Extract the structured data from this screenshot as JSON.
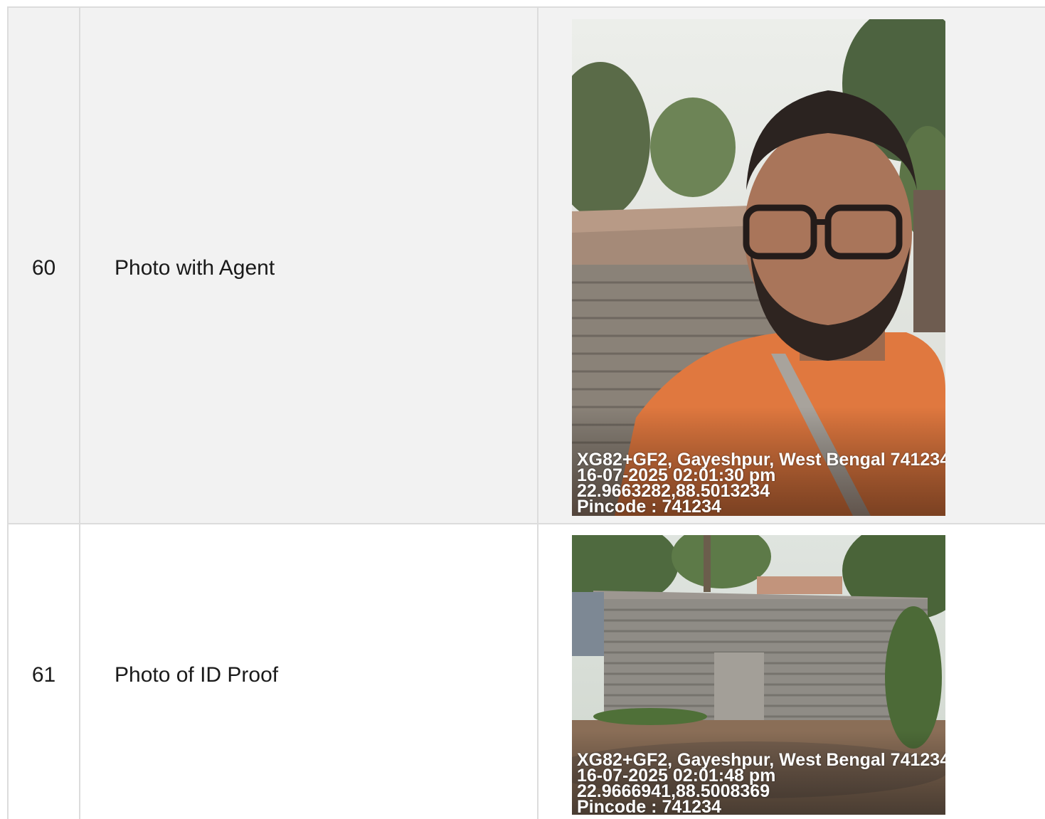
{
  "rows": [
    {
      "number": "60",
      "label": "Photo with Agent",
      "photo": {
        "subject": "selfie of man in orange t-shirt in front of tin shed",
        "stamp": {
          "address": "XG82+GF2, Gayeshpur, West Bengal 741234,",
          "datetime": "16-07-2025 02:01:30 pm",
          "coords": "22.9663282,88.5013234",
          "pincode": "Pincode : 741234"
        }
      }
    },
    {
      "number": "61",
      "label": "Photo of ID Proof",
      "photo": {
        "subject": "corrugated tin shed among trees",
        "stamp": {
          "address": "XG82+GF2, Gayeshpur, West Bengal 741234",
          "datetime": "16-07-2025 02:01:48 pm",
          "coords": "22.9666941,88.5008369",
          "pincode": "Pincode : 741234"
        }
      }
    }
  ]
}
